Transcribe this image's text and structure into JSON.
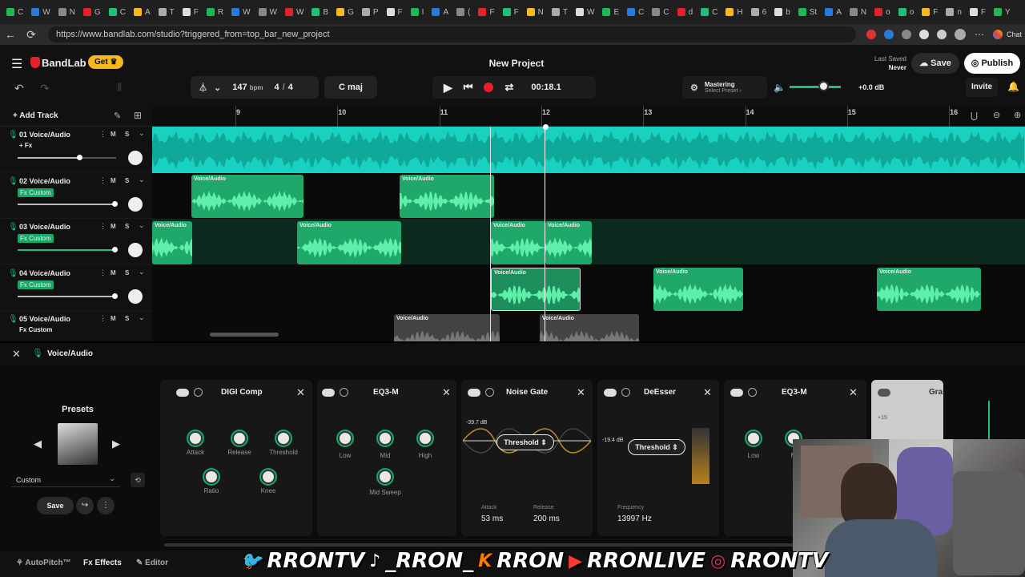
{
  "browser": {
    "url": "https://www.bandlab.com/studio?triggered_from=top_bar_new_project",
    "tabs": [
      "C",
      "W",
      "N",
      "G",
      "C",
      "A",
      "T",
      "F",
      "R",
      "W",
      "W",
      "W",
      "B",
      "G",
      "P",
      "F",
      "I",
      "A",
      "(",
      "F",
      "F",
      "N",
      "T",
      "W",
      "E",
      "C",
      "C",
      "d",
      "C",
      "H",
      "6",
      "b",
      "St",
      "A",
      "N",
      "o",
      "o",
      "F",
      "n",
      "F",
      "Y"
    ],
    "chat_label": "Chat"
  },
  "app": {
    "logo": "BandLab",
    "get_label": "Get",
    "project_title": "New Project",
    "last_saved_label": "Last Saved",
    "last_saved_value": "Never",
    "save_label": "Save",
    "publish_label": "Publish",
    "invite_label": "Invite",
    "bpm_value": "147",
    "bpm_unit": "bpm",
    "time_sig_num": "4",
    "time_sig_sep": "/",
    "time_sig_den": "4",
    "key": "C maj",
    "time_display": "00:18.1",
    "mastering_label": "Mastering",
    "select_preset_label": "Select Preset",
    "gain_value": "+0.0 dB",
    "add_track_label": "Add Track"
  },
  "ruler": {
    "marks": [
      "9",
      "10",
      "11",
      "12",
      "13",
      "14",
      "15",
      "16"
    ]
  },
  "tracks": [
    {
      "name": "01 Voice/Audio",
      "fx": "+ Fx",
      "fx_style": "plain",
      "slider": 0.63
    },
    {
      "name": "02 Voice/Audio",
      "fx": "Fx Custom",
      "fx_style": "badge",
      "slider": 0.98
    },
    {
      "name": "03 Voice/Audio",
      "fx": "Fx Custom",
      "fx_style": "badge",
      "slider": 0.98
    },
    {
      "name": "04 Voice/Audio",
      "fx": "Fx Custom",
      "fx_style": "badge",
      "slider": 0.98
    },
    {
      "name": "05 Voice/Audio",
      "fx": "Fx Custom",
      "fx_style": "plain",
      "slider": 0.98
    }
  ],
  "track_buttons": {
    "mute": "M",
    "solo": "S",
    "level_left": "L",
    "level_right": "R"
  },
  "clip_label": "Voice/Audio",
  "fx_panel": {
    "track_name": "Voice/Audio",
    "presets_label": "Presets",
    "preset_value": "Custom",
    "save_label": "Save",
    "effects": [
      {
        "title": "DIGI Comp",
        "knobs": [
          "Attack",
          "Release",
          "Threshold",
          "Ratio",
          "Knee"
        ]
      },
      {
        "title": "EQ3-M",
        "knobs": [
          "Low",
          "Mid",
          "High",
          "Mid Sweep"
        ]
      },
      {
        "title": "Noise Gate",
        "db": "-39.7 dB",
        "threshold": "Threshold",
        "attack_label": "Attack",
        "attack_value": "53 ms",
        "release_label": "Release",
        "release_value": "200 ms"
      },
      {
        "title": "DeEsser",
        "db": "-19.4 dB",
        "threshold": "Threshold",
        "freq_label": "Frequency",
        "freq_value": "13997 Hz"
      },
      {
        "title": "EQ3-M",
        "knobs": [
          "Low",
          "M"
        ]
      }
    ],
    "partial_title": "Gra",
    "meter_value": "+15"
  },
  "bottom_tabs": [
    "AutoPitch™",
    "Effects",
    "Editor"
  ],
  "social": [
    "RRONTV",
    "_RRON_",
    "RRON",
    "RRONLIVE",
    "RRONTV"
  ],
  "colors": {
    "teal": "#19d1c0",
    "green": "#1fbf78",
    "green_dark": "#0f5a3a",
    "record": "#e8202a",
    "get_yellow": "#f6b81b"
  }
}
